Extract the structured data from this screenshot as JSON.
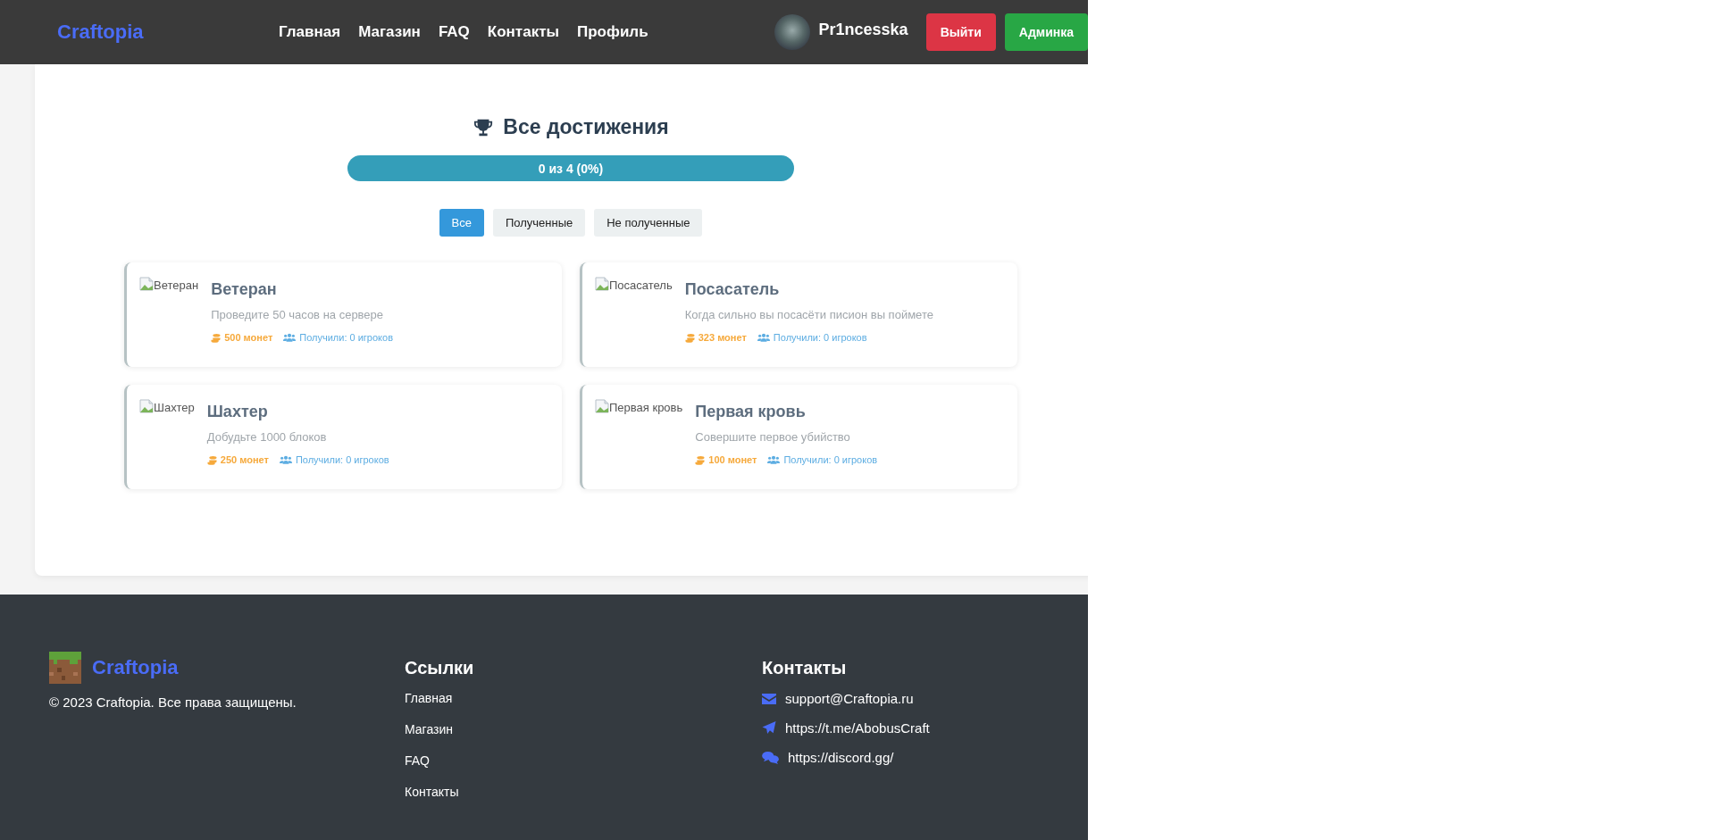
{
  "header": {
    "brand": "Craftopia",
    "nav": [
      {
        "label": "Главная"
      },
      {
        "label": "Магазин"
      },
      {
        "label": "FAQ"
      },
      {
        "label": "Контакты"
      },
      {
        "label": "Профиль"
      }
    ],
    "username": "Pr1ncesska",
    "logout": "Выйти",
    "admin": "Админка"
  },
  "achievements": {
    "title": "Все достижения",
    "progress": {
      "text": "0 из 4 (0%)",
      "level": 0
    },
    "filters": [
      {
        "label": "Все",
        "selected": true
      },
      {
        "label": "Полученные",
        "selected": false
      },
      {
        "label": "Не полученные",
        "selected": false
      }
    ],
    "items": [
      {
        "image_alt": "Ветеран",
        "name": "Ветеран",
        "description": "Проведите 50 часов на сервере",
        "reward": "500 монет",
        "received": "Получили: 0 игроков"
      },
      {
        "image_alt": "Посасатель",
        "name": "Посасатель",
        "description": "Когда сильно вы посасёти писион вы поймете",
        "reward": "323 монет",
        "received": "Получили: 0 игроков"
      },
      {
        "image_alt": "Шахтер",
        "name": "Шахтер",
        "description": "Добудьте 1000 блоков",
        "reward": "250 монет",
        "received": "Получили: 0 игроков"
      },
      {
        "image_alt": "Первая кровь",
        "name": "Первая кровь",
        "description": "Совершите первое убийство",
        "reward": "100 монет",
        "received": "Получили: 0 игроков"
      }
    ]
  },
  "footer": {
    "brand": "Craftopia",
    "copyright": "© 2023 Craftopia. Все права защищены.",
    "links_title": "Ссылки",
    "links": [
      "Главная",
      "Магазин",
      "FAQ",
      "Контакты"
    ],
    "contacts_title": "Контакты",
    "contacts": [
      {
        "kind": "email",
        "text": "support@Craftopia.ru"
      },
      {
        "kind": "telegram",
        "text": "https://t.me/AbobusCraft"
      },
      {
        "kind": "discord",
        "text": "https://discord.gg/"
      }
    ]
  }
}
